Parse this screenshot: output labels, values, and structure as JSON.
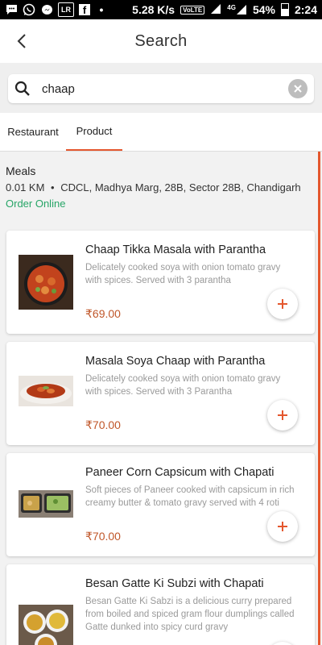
{
  "status_bar": {
    "speed": "5.28 K/s",
    "volte": "VoLTE",
    "network": "4G",
    "battery": "54%",
    "time": "2:24",
    "left_icons": [
      "messages-icon",
      "whatsapp-icon",
      "messenger-icon",
      "linkedin-icon",
      "facebook-icon"
    ],
    "more": "•"
  },
  "header": {
    "title": "Search"
  },
  "search": {
    "value": "chaap",
    "placeholder": ""
  },
  "tabs": [
    {
      "label": "Restaurant",
      "active": false
    },
    {
      "label": "Product",
      "active": true
    }
  ],
  "restaurant": {
    "name": "Meals",
    "distance": "0.01 KM",
    "separator": "•",
    "address": "CDCL, Madhya Marg, 28B, Sector 28B, Chandigarh",
    "status": "Order Online"
  },
  "products": [
    {
      "name": "Chaap Tikka Masala with Parantha",
      "description": "Delicately cooked soya with onion tomato gravy with spices. Served with 3 parantha",
      "price": "₹69.00"
    },
    {
      "name": "Masala Soya Chaap with Parantha",
      "description": "Delicately cooked soya with onion tomato gravy with spices. Served with 3 Parantha",
      "price": "₹70.00"
    },
    {
      "name": "Paneer Corn Capsicum with Chapati",
      "description": "Soft pieces of Paneer cooked with capsicum in rich creamy butter & tomato gravy served with 4 roti",
      "price": "₹70.00"
    },
    {
      "name": "Besan Gatte Ki Subzi with Chapati",
      "description": "Besan Gatte Ki Sabzi is a delicious curry prepared from boiled and spiced gram flour dumplings called Gatte dunked into spicy curd gravy",
      "price": ""
    }
  ],
  "colors": {
    "accent": "#e4572e",
    "price": "#c0572a",
    "online": "#27a567",
    "muted_text": "#9a9a9a"
  }
}
